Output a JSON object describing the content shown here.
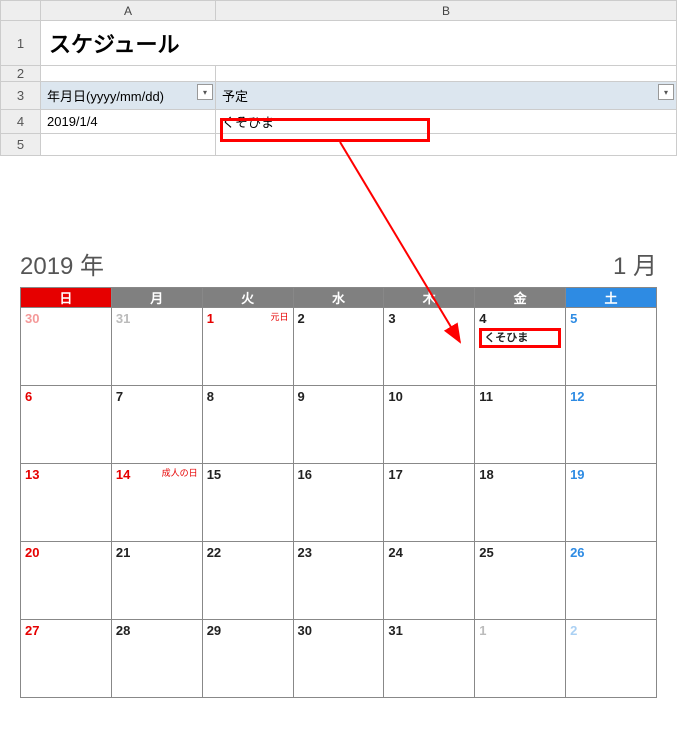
{
  "sheet": {
    "columns": {
      "A": "A",
      "B": "B"
    },
    "rows": {
      "r1": "1",
      "r2": "2",
      "r3": "3",
      "r4": "4",
      "r5": "5"
    },
    "title": "スケジュール",
    "headers": {
      "date": "年月日(yyyy/mm/dd)",
      "plan": "予定"
    },
    "row4": {
      "date": "2019/1/4",
      "plan": "くそひま"
    }
  },
  "calendar": {
    "year": "2019 年",
    "month": "1 月",
    "dayLabels": {
      "sun": "日",
      "mon": "月",
      "tue": "火",
      "wed": "水",
      "thu": "木",
      "fri": "金",
      "sat": "土"
    },
    "cells": {
      "w1": {
        "sun": "30",
        "mon": "31",
        "tue": "1",
        "tueHol": "元日",
        "wed": "2",
        "thu": "3",
        "fri": "4",
        "friEvent": "くそひま",
        "sat": "5"
      },
      "w2": {
        "sun": "6",
        "mon": "7",
        "tue": "8",
        "wed": "9",
        "thu": "10",
        "fri": "11",
        "sat": "12"
      },
      "w3": {
        "sun": "13",
        "mon": "14",
        "monHol": "成人の日",
        "tue": "15",
        "wed": "16",
        "thu": "17",
        "fri": "18",
        "sat": "19"
      },
      "w4": {
        "sun": "20",
        "mon": "21",
        "tue": "22",
        "wed": "23",
        "thu": "24",
        "fri": "25",
        "sat": "26"
      },
      "w5": {
        "sun": "27",
        "mon": "28",
        "tue": "29",
        "wed": "30",
        "thu": "31",
        "fri": "1",
        "sat": "2"
      }
    }
  }
}
